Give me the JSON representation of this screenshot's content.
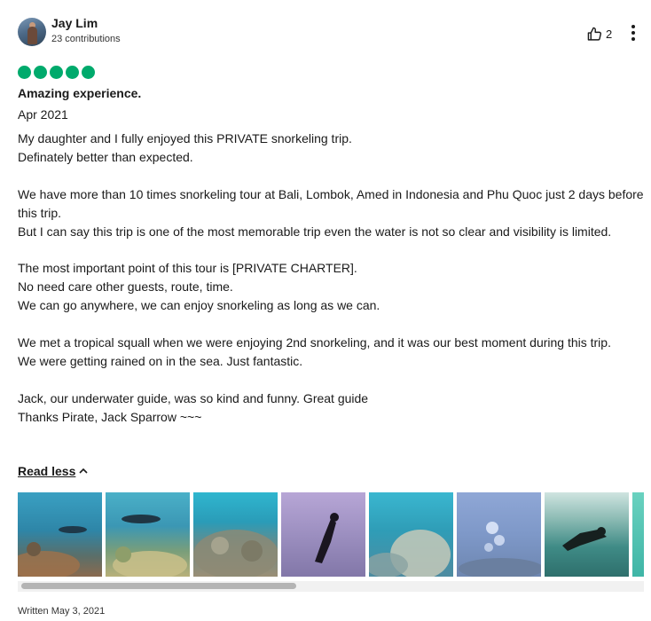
{
  "author": {
    "name": "Jay Lim",
    "contributions": "23 contributions",
    "avatar_icon": "user-avatar"
  },
  "helpful": {
    "icon": "thumbs-up-icon",
    "count": "2"
  },
  "menu_icon": "more-options-icon",
  "rating": {
    "value": 5,
    "max": 5,
    "color": "#00aa6c"
  },
  "review": {
    "title": "Amazing experience.",
    "date": "Apr 2021",
    "paragraphs": [
      "My daughter and I fully enjoyed this PRIVATE snorkeling trip.\nDefinately better than expected.",
      "We have more than 10 times snorkeling tour at Bali, Lombok, Amed in Indonesia and Phu Quoc just 2 days before this trip.\nBut I can say this trip is one of the most memorable trip even the water is not so clear and visibility is limited.",
      "The most important point of this tour is [PRIVATE CHARTER].\nNo need care other guests, route, time.\nWe can go anywhere, we can enjoy snorkeling as long as we can.",
      "We met a tropical squall when we were enjoying 2nd snorkeling, and it was our best moment during this trip.\nWe were getting rained on in the sea. Just fantastic.",
      "Jack, our underwater guide, was so kind and funny. Great guide\nThanks Pirate, Jack Sparrow ~~~"
    ],
    "read_less_label": "Read less"
  },
  "photos": [
    {
      "name": "underwater-photo-1"
    },
    {
      "name": "underwater-photo-2"
    },
    {
      "name": "underwater-photo-3"
    },
    {
      "name": "underwater-photo-4"
    },
    {
      "name": "underwater-photo-5"
    },
    {
      "name": "underwater-photo-6"
    },
    {
      "name": "underwater-photo-7"
    },
    {
      "name": "underwater-photo-8"
    }
  ],
  "written": "Written May 3, 2021"
}
